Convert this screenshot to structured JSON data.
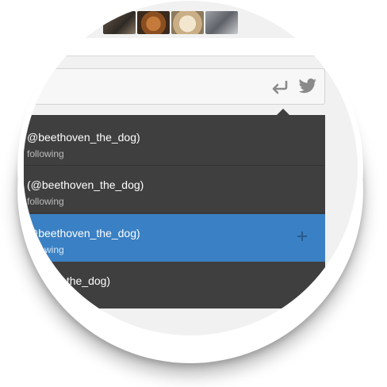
{
  "avatars": [
    {
      "icon": "dog-avatar-dark"
    },
    {
      "icon": "dog-avatar-brown"
    },
    {
      "icon": "dog-avatar-cream"
    },
    {
      "icon": "dog-avatar-grey"
    }
  ],
  "compose": {
    "reply_icon": "reply-icon",
    "twitter_icon": "twitter-bird-icon"
  },
  "dropdown": {
    "items": [
      {
        "name": "@beethoven_the_dog)",
        "sub": "following",
        "selected": false
      },
      {
        "name": "(@beethoven_the_dog)",
        "sub": "following",
        "selected": false
      },
      {
        "name": "@beethoven_the_dog)",
        "sub": "following",
        "selected": true,
        "action_icon": "plus-icon"
      },
      {
        "name": "thoven_the_dog)",
        "sub": "",
        "selected": false
      }
    ]
  },
  "colors": {
    "dropdown_bg": "#3f3f3f",
    "selected_bg": "#3a80c4",
    "page_bg": "#f1f1f1"
  }
}
